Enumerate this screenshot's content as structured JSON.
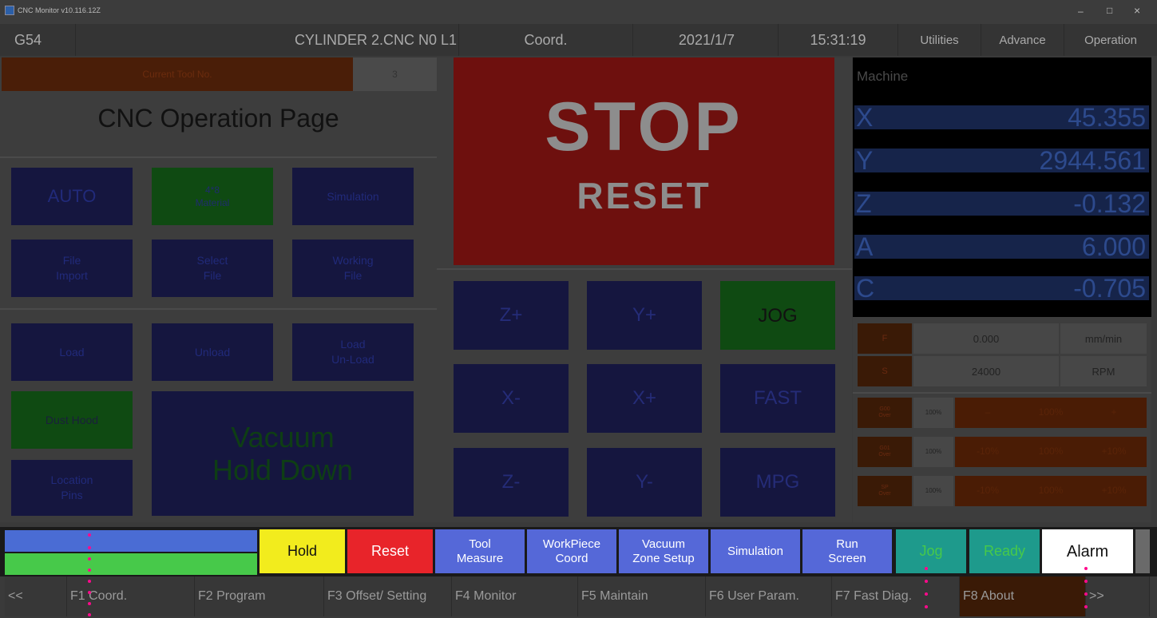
{
  "window": {
    "title": "CNC Monitor v10.116.12Z",
    "min": "–",
    "max": "□",
    "close": "×"
  },
  "topbar": {
    "coord_sys": "G54",
    "filename": "CYLINDER 2.CNC N0 L1",
    "coord": "Coord.",
    "date": "2021/1/7",
    "time": "15:31:19",
    "utilities": "Utilities",
    "advance": "Advance",
    "operation": "Operation"
  },
  "left": {
    "tool_label": "Current Tool No.",
    "tool_no": "3",
    "page_title": "CNC Operation Page",
    "auto": "AUTO",
    "material": "4*8\nMaterial",
    "simulation": "Simulation",
    "file_import": "File\nImport",
    "select_file": "Select\nFile",
    "working_file": "Working\nFile",
    "load": "Load",
    "unload": "Unload",
    "load_unload": "Load\nUn-Load",
    "dust_hood": "Dust Hood",
    "vacuum": "Vacuum\nHold Down",
    "location_pins": "Location\nPins"
  },
  "center": {
    "stop": "STOP",
    "reset": "RESET",
    "jog_buttons": [
      "Z+",
      "Y+",
      "JOG",
      "X-",
      "X+",
      "FAST",
      "Z-",
      "Y-",
      "MPG"
    ]
  },
  "machine": {
    "label": "Machine",
    "axes": [
      {
        "axis": "X",
        "value": "45.355"
      },
      {
        "axis": "Y",
        "value": "2944.561"
      },
      {
        "axis": "Z",
        "value": "-0.132"
      },
      {
        "axis": "A",
        "value": "6.000"
      },
      {
        "axis": "C",
        "value": "-0.705"
      }
    ]
  },
  "feed": {
    "f_label": "F",
    "f_value": "0.000",
    "f_unit": "mm/min",
    "s_label": "S",
    "s_value": "24000",
    "s_unit": "RPM"
  },
  "overrides": [
    {
      "label": "G00\nOver",
      "current": "100%",
      "minus": "–",
      "mid": "100%",
      "plus": "+"
    },
    {
      "label": "G01\nOver",
      "current": "100%",
      "minus": "-10%",
      "mid": "100%",
      "plus": "+10%"
    },
    {
      "label": "SP\nOver",
      "current": "100%",
      "minus": "-10%",
      "mid": "100%",
      "plus": "+10%"
    }
  ],
  "status": {
    "hold": "Hold",
    "reset": "Reset",
    "tool_measure": "Tool\nMeasure",
    "workpiece_coord": "WorkPiece\nCoord",
    "vacuum_zone": "Vacuum\nZone Setup",
    "simulation": "Simulation",
    "run_screen": "Run\nScreen",
    "jog": "Jog",
    "ready": "Ready",
    "alarm": "Alarm"
  },
  "fkeys": [
    "<<",
    "F1 Coord.",
    "F2 Program",
    "F3 Offset/ Setting",
    "F4 Monitor",
    "F5 Maintain",
    "F6 User Param.",
    "F7 Fast Diag.",
    "F8 About",
    ">>"
  ],
  "colors": {
    "hold": "#f2ec1d",
    "reset": "#e8242a",
    "blue_btn": "#5568d8",
    "green": "#47c94a",
    "jog_teal": "#1e9a8c",
    "alarm_bg": "#ffffff"
  }
}
